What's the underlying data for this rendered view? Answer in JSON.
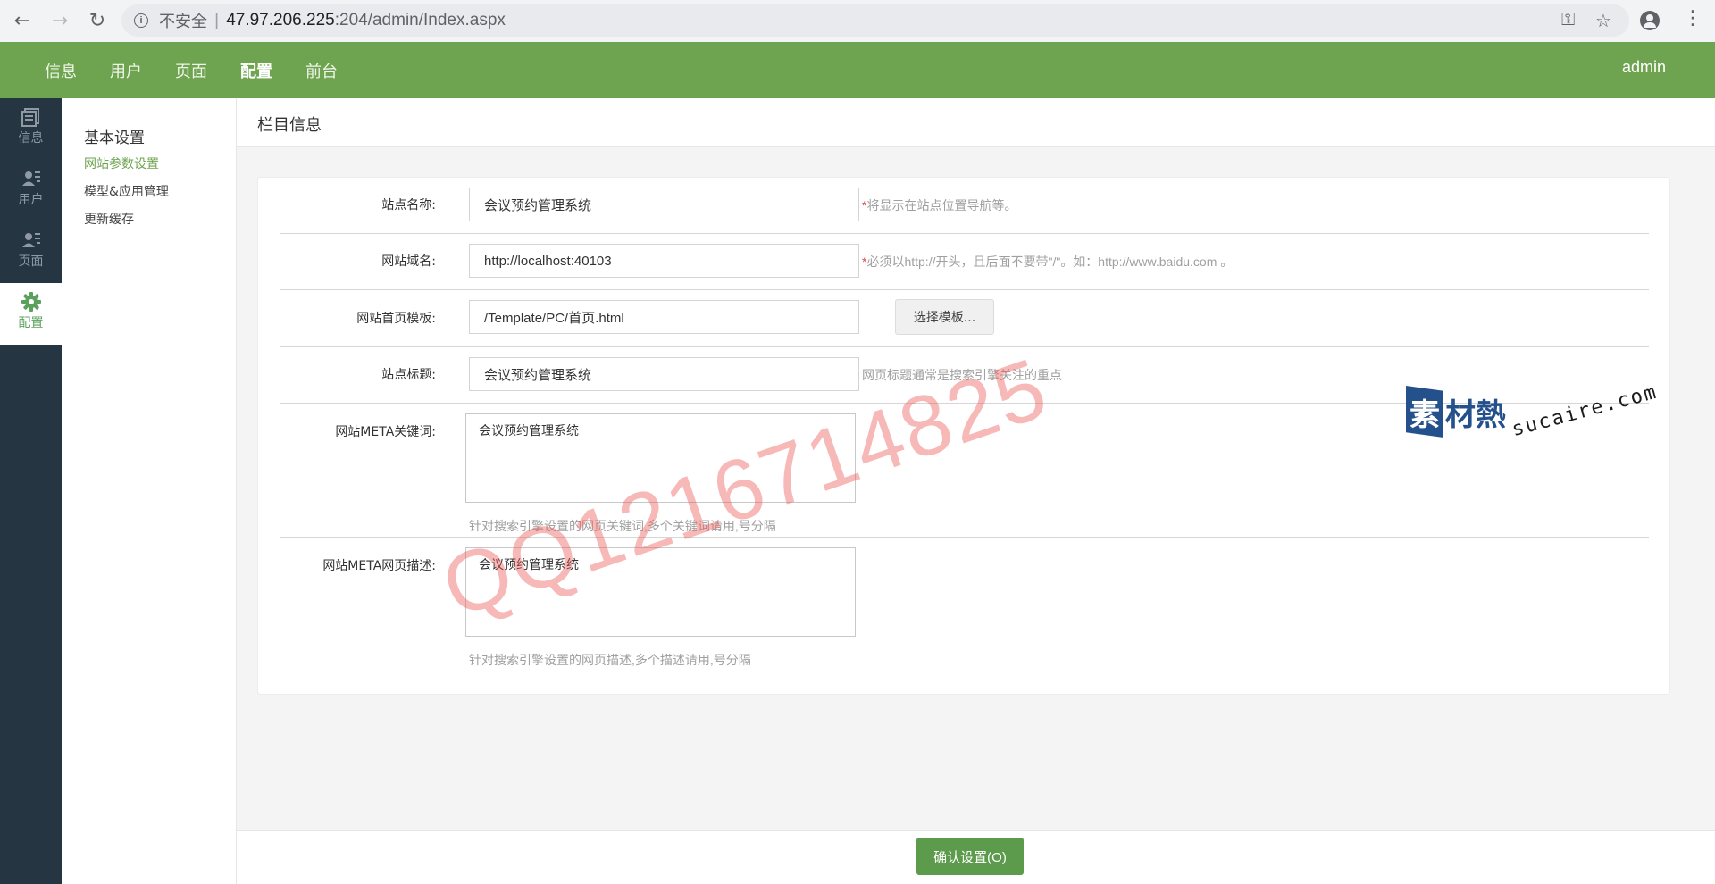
{
  "browser": {
    "insecure_label": "不安全",
    "separator": "|",
    "url_host": "47.97.206.225",
    "url_path": ":204/admin/Index.aspx"
  },
  "topnav": {
    "items": [
      {
        "label": "信息"
      },
      {
        "label": "用户"
      },
      {
        "label": "页面"
      },
      {
        "label": "配置"
      },
      {
        "label": "前台"
      }
    ],
    "active": "配置",
    "user": "admin"
  },
  "rail": {
    "items": [
      {
        "label": "信息",
        "icon": "document-icon"
      },
      {
        "label": "用户",
        "icon": "user-list-icon"
      },
      {
        "label": "页面",
        "icon": "user-list-icon"
      },
      {
        "label": "配置",
        "icon": "gear-icon"
      }
    ],
    "active_color": "#5aa15c",
    "bg_color": "#263542"
  },
  "submenu": {
    "title": "基本设置",
    "links": [
      {
        "label": "网站参数设置"
      },
      {
        "label": "模型&应用管理"
      },
      {
        "label": "更新缓存"
      }
    ]
  },
  "main": {
    "title": "栏目信息",
    "form": {
      "site_name": {
        "label": "站点名称:",
        "value": "会议预约管理系统",
        "required": "*",
        "hint": "将显示在站点位置导航等。"
      },
      "domain": {
        "label": "网站域名:",
        "value": "http://localhost:40103",
        "required": "*",
        "hint": "必须以http://开头，且后面不要带\"/\"。如：http://www.baidu.com 。"
      },
      "template": {
        "label": "网站首页模板:",
        "value": "/Template/PC/首页.html",
        "button": "选择模板..."
      },
      "site_title": {
        "label": "站点标题:",
        "value": "会议预约管理系统",
        "hint": "网页标题通常是搜索引擎关注的重点"
      },
      "meta_keywords": {
        "label": "网站META关键词:",
        "value": "会议预约管理系统",
        "hint": "针对搜索引擎设置的网页关键词,多个关键词请用,号分隔"
      },
      "meta_description": {
        "label": "网站META网页描述:",
        "value": "会议预约管理系统",
        "hint": "针对搜索引擎设置的网页描述,多个描述请用,号分隔"
      }
    },
    "confirm_button": "确认设置(O)"
  },
  "watermarks": {
    "qq": "QQ1216714825",
    "logo_badge": "素",
    "logo_text": "材熱",
    "domain": "sucaire.com"
  },
  "colors": {
    "header_green": "#6ea34f",
    "button_green": "#5c9b4b",
    "required_red": "#e04848"
  }
}
